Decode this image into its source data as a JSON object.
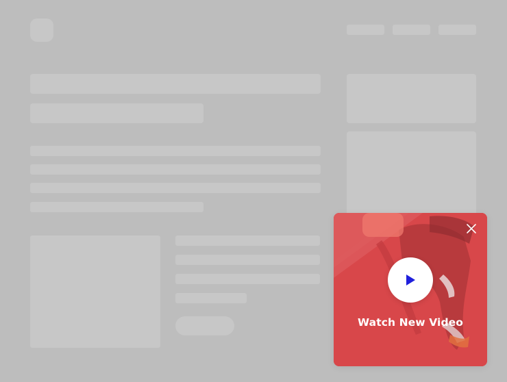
{
  "page": {
    "background_color": "#bdbdbd",
    "skeleton_color": "#c7c7c7"
  },
  "video_popup": {
    "label": "Watch New Video",
    "background_color": "#d8474a",
    "play_icon_color": "#1f1fdc",
    "icons": [
      "play-icon",
      "close-icon"
    ]
  }
}
